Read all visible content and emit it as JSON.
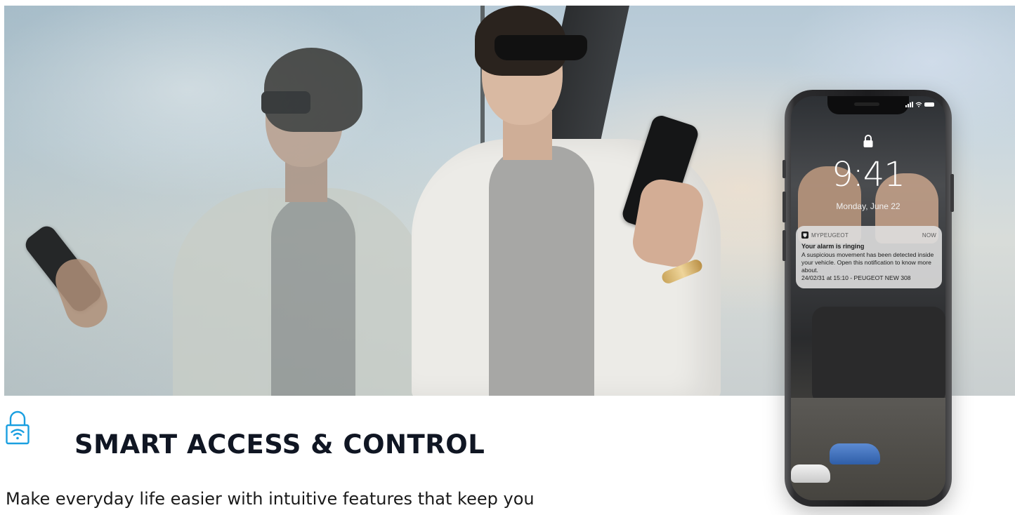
{
  "hero": {
    "image_alt": "Woman holding a smartphone leaning against a glass wall"
  },
  "phone": {
    "lock_time": "9:41",
    "lock_date": "Monday, June 22",
    "notification": {
      "app_name": "MYPEUGEOT",
      "time_label": "NOW",
      "title": "Your alarm is ringing",
      "body": "A suspicious movement has been detected inside your vehicle. Open this notification to know more about.",
      "meta": "24/02/31 at 15:10 - PEUGEOT NEW 308"
    }
  },
  "feature": {
    "icon": "lock-wifi-icon",
    "title": "SMART ACCESS & CONTROL",
    "description": "Make everyday life easier with intuitive features that keep you"
  },
  "colors": {
    "accent": "#1a9fe0",
    "title_text": "#101623",
    "body_text": "#1a1a1a"
  }
}
